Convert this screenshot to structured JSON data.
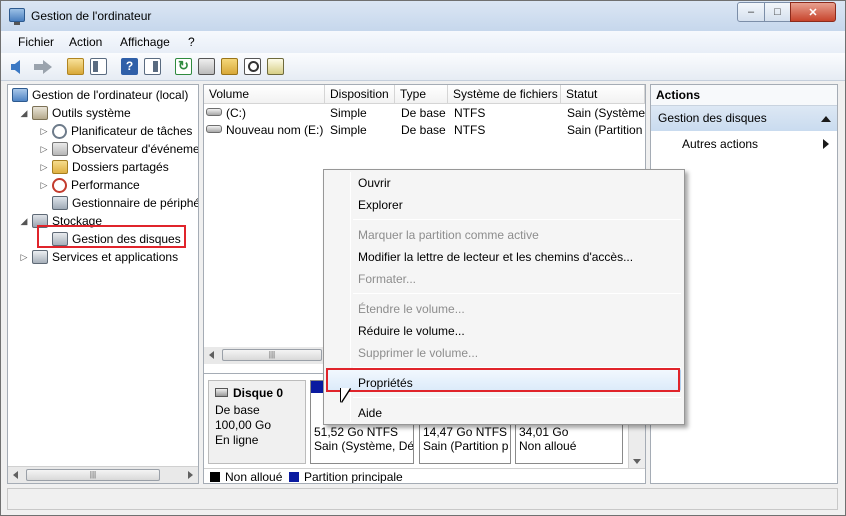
{
  "window": {
    "title": "Gestion de l'ordinateur",
    "controls": {
      "minimize": "–",
      "maximize": "□",
      "close": "✕"
    }
  },
  "menubar": {
    "items": [
      "Fichier",
      "Action",
      "Affichage",
      "?"
    ]
  },
  "toolbar": {
    "icons": [
      "back-arrow-icon",
      "forward-arrow-icon",
      "up-folder-icon",
      "show-hide-tree-icon",
      "help-icon",
      "show-hide-action-pane-icon",
      "refresh-icon",
      "properties-icon",
      "open-icon",
      "find-icon",
      "disk-icon"
    ],
    "help_glyph": "?"
  },
  "tree": {
    "root": "Gestion de l'ordinateur (local)",
    "items": [
      {
        "label": "Outils système",
        "icon": "tools-icon",
        "expander": "◢"
      },
      {
        "label": "Planificateur de tâches",
        "icon": "clock-icon",
        "expander": "▷"
      },
      {
        "label": "Observateur d'événeme",
        "icon": "event-viewer-icon",
        "expander": "▷"
      },
      {
        "label": "Dossiers partagés",
        "icon": "shared-folder-icon",
        "expander": "▷"
      },
      {
        "label": "Performance",
        "icon": "performance-icon",
        "expander": "▷"
      },
      {
        "label": "Gestionnaire de périphé",
        "icon": "device-manager-icon",
        "expander": ""
      },
      {
        "label": "Stockage",
        "icon": "storage-icon",
        "expander": "◢"
      },
      {
        "label": "Gestion des disques",
        "icon": "disk-management-icon",
        "expander": ""
      },
      {
        "label": "Services et applications",
        "icon": "services-icon",
        "expander": "▷"
      }
    ],
    "scroll_thumb": "|||"
  },
  "volume_list": {
    "columns": [
      "Volume",
      "Disposition",
      "Type",
      "Système de fichiers",
      "Statut"
    ],
    "rows": [
      {
        "volume": "(C:)",
        "disposition": "Simple",
        "type": "De base",
        "fs": "NTFS",
        "status": "Sain (Système,"
      },
      {
        "volume": "Nouveau nom (E:)",
        "disposition": "Simple",
        "type": "De base",
        "fs": "NTFS",
        "status": "Sain (Partition"
      }
    ],
    "scroll_thumb": "|||"
  },
  "disk": {
    "name": "Disque 0",
    "type": "De base",
    "size": "100,00 Go",
    "state": "En ligne",
    "partitions": [
      {
        "size": "51,52 Go NTFS",
        "status": "Sain (Système, Dé",
        "kind": "primary"
      },
      {
        "size": "14,47 Go NTFS",
        "status": "Sain (Partition p",
        "kind": "primary"
      },
      {
        "size": "34,01 Go",
        "status": "Non alloué",
        "kind": "unallocated"
      }
    ]
  },
  "legend": {
    "items": [
      {
        "label": "Non alloué",
        "color": "#000000"
      },
      {
        "label": "Partition principale",
        "color": "#0a1aa0"
      }
    ]
  },
  "actions": {
    "header": "Actions",
    "section": "Gestion des disques",
    "item": "Autres actions"
  },
  "context_menu": {
    "items": [
      {
        "label": "Ouvrir",
        "enabled": true
      },
      {
        "label": "Explorer",
        "enabled": true
      },
      {
        "label": "Marquer la partition comme active",
        "enabled": false
      },
      {
        "label": "Modifier la lettre de lecteur et les chemins d'accès...",
        "enabled": true
      },
      {
        "label": "Formater...",
        "enabled": false
      },
      {
        "label": "Étendre le volume...",
        "enabled": false
      },
      {
        "label": "Réduire le volume...",
        "enabled": true
      },
      {
        "label": "Supprimer le volume...",
        "enabled": false
      },
      {
        "label": "Propriétés",
        "enabled": true
      },
      {
        "label": "Aide",
        "enabled": true
      }
    ],
    "highlighted": "Propriétés"
  },
  "colors": {
    "highlight_frame": "#e0242b",
    "primary_partition": "#0a1aa0",
    "unallocated": "#000000"
  }
}
